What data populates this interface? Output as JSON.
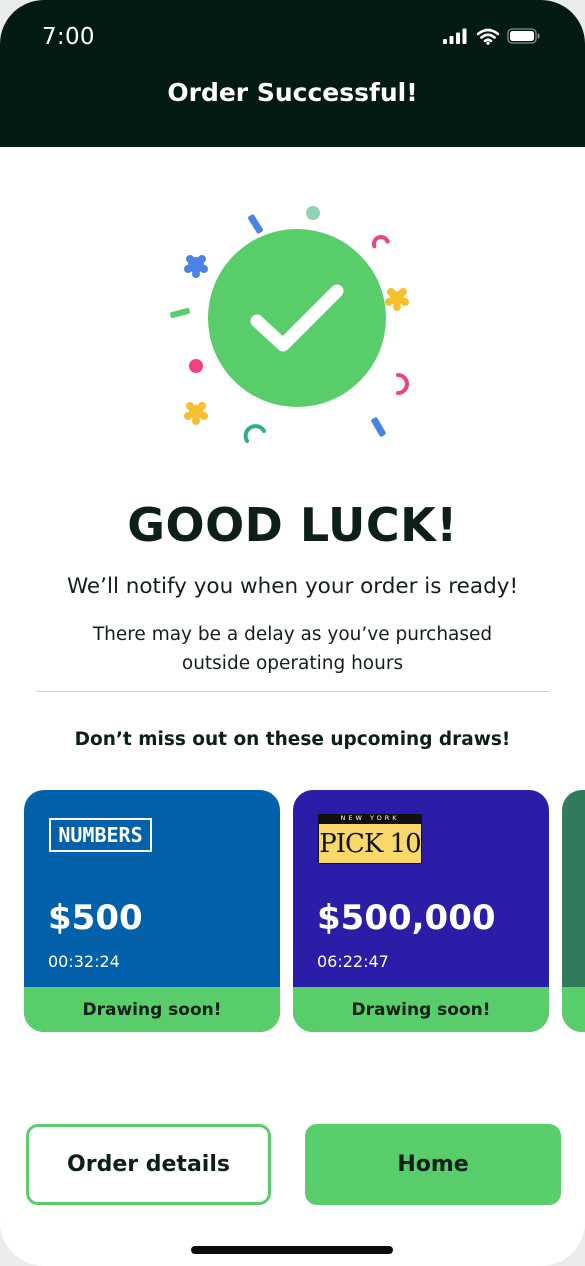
{
  "status_bar": {
    "time": "7:00",
    "icons": [
      "signal-icon",
      "wifi-icon",
      "battery-icon"
    ]
  },
  "header": {
    "title": "Order Successful!",
    "background": "#031a15"
  },
  "hero": {
    "icon": "check-circle-icon",
    "decoration": "confetti",
    "accent": "#58cd6a"
  },
  "main": {
    "headline": "GOOD LUCK!",
    "notify_text": "We’ll notify you when your order is ready!",
    "delay_text": "There may be a delay as you’ve purchased outside operating hours",
    "upcoming_title": "Don’t miss out on these upcoming draws!"
  },
  "draws": [
    {
      "logo_text": "NUMBERS",
      "amount": "$500",
      "timer": "00:32:24",
      "status": "Drawing soon!",
      "color": "#0360ab"
    },
    {
      "logo_top": "NEW YORK",
      "logo_text": "PICK 10",
      "amount": "$500,000",
      "timer": "06:22:47",
      "status": "Drawing soon!",
      "color": "#2a1ea8"
    }
  ],
  "peek_card_color": "#2f7b5b",
  "actions": {
    "order_details": "Order details",
    "home": "Home"
  }
}
